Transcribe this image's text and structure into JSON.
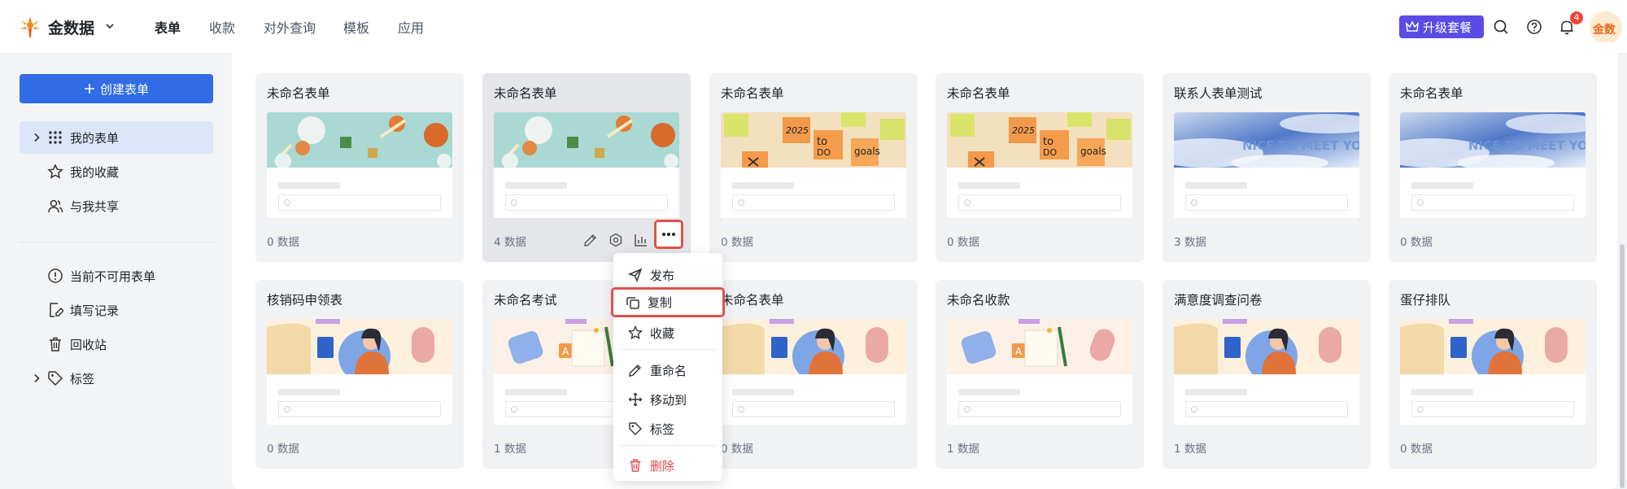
{
  "header": {
    "brand": "金数据",
    "nav": [
      "表单",
      "收款",
      "对外查询",
      "模板",
      "应用"
    ],
    "upgrade_label": "升级套餐",
    "notification_count": "4",
    "avatar_text": "金数"
  },
  "sidebar": {
    "create_label": "创建表单",
    "items": [
      {
        "label": "我的表单",
        "icon": "grid-icon"
      },
      {
        "label": "我的收藏",
        "icon": "star-icon"
      },
      {
        "label": "与我共享",
        "icon": "users-icon"
      },
      {
        "label": "当前不可用表单",
        "icon": "alert-circle-icon"
      },
      {
        "label": "填写记录",
        "icon": "edit-record-icon"
      },
      {
        "label": "回收站",
        "icon": "trash-icon"
      },
      {
        "label": "标签",
        "icon": "tag-icon"
      }
    ]
  },
  "cards": [
    {
      "title": "未命名表单",
      "count": "0 数据",
      "theme": "party"
    },
    {
      "title": "未命名表单",
      "count": "4 数据",
      "theme": "party"
    },
    {
      "title": "未命名表单",
      "count": "0 数据",
      "theme": "notes"
    },
    {
      "title": "未命名表单",
      "count": "0 数据",
      "theme": "notes"
    },
    {
      "title": "联系人表单测试",
      "count": "3 数据",
      "theme": "sky"
    },
    {
      "title": "未命名表单",
      "count": "0 数据",
      "theme": "sky"
    },
    {
      "title": "核销码申领表",
      "count": "0 数据",
      "theme": "person"
    },
    {
      "title": "未命名考试",
      "count": "1 数据",
      "theme": "shapes"
    },
    {
      "title": "未命名表单",
      "count": "0 数据",
      "theme": "person"
    },
    {
      "title": "未命名收款",
      "count": "1 数据",
      "theme": "shapes"
    },
    {
      "title": "满意度调查问卷",
      "count": "1 数据",
      "theme": "person"
    },
    {
      "title": "蛋仔排队",
      "count": "0 数据",
      "theme": "person"
    }
  ],
  "thumb_texts": {
    "sky": "NICE TO MEET YOU"
  },
  "context_menu": {
    "items": [
      {
        "label": "发布",
        "icon": "send-icon"
      },
      {
        "label": "复制",
        "icon": "copy-icon"
      },
      {
        "label": "收藏",
        "icon": "star-icon"
      },
      {
        "label": "重命名",
        "icon": "pencil-icon"
      },
      {
        "label": "移动到",
        "icon": "move-icon"
      },
      {
        "label": "标签",
        "icon": "tag-icon"
      },
      {
        "label": "删除",
        "icon": "trash-icon"
      }
    ]
  },
  "colors": {
    "primary": "#2f6ce5",
    "upgrade": "#5b4be6",
    "danger": "#e5484d",
    "highlight": "#e0524a"
  }
}
